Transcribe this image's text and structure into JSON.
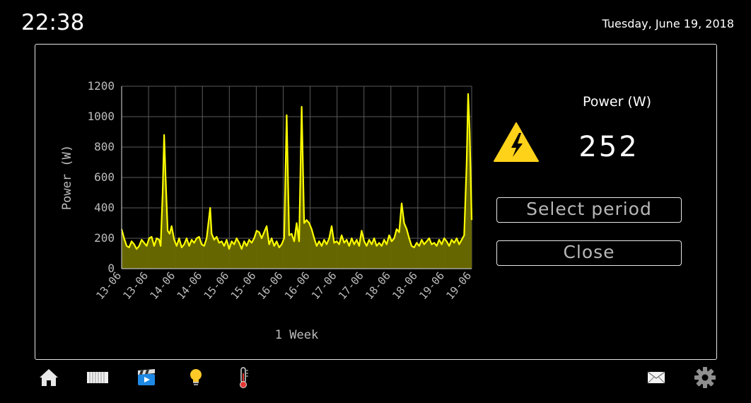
{
  "header": {
    "time": "22:38",
    "date": "Tuesday, June 19, 2018"
  },
  "power_panel": {
    "title": "Power (W)",
    "value": "252",
    "select_period_label": "Select period",
    "close_label": "Close",
    "icon": "high-voltage-warning-icon"
  },
  "nav": {
    "left": [
      "home-icon",
      "radiator-icon",
      "media-clapperboard-icon",
      "light-bulb-icon",
      "thermometer-icon"
    ],
    "right": [
      "mail-icon",
      "settings-gear-icon"
    ]
  },
  "colors": {
    "line": "#ffff00",
    "fill": "#6b6b00",
    "grid": "#5a5a5a",
    "axis_text": "#bdbdbd"
  },
  "chart_data": {
    "type": "area",
    "title": "",
    "xlabel": "1 Week",
    "ylabel": "Power (W)",
    "ylim": [
      0,
      1200
    ],
    "yticks": [
      0,
      200,
      400,
      600,
      800,
      1000,
      1200
    ],
    "xlim": [
      0,
      7
    ],
    "xtick_labels": [
      "13-06",
      "13-06",
      "14-06",
      "14-06",
      "15-06",
      "15-06",
      "16-06",
      "16-06",
      "17-06",
      "17-06",
      "18-06",
      "18-06",
      "19-06",
      "19-06"
    ],
    "grid": true,
    "series": [
      {
        "values": [
          [
            0.0,
            260
          ],
          [
            0.05,
            200
          ],
          [
            0.1,
            150
          ],
          [
            0.15,
            140
          ],
          [
            0.2,
            180
          ],
          [
            0.25,
            160
          ],
          [
            0.3,
            130
          ],
          [
            0.35,
            150
          ],
          [
            0.4,
            190
          ],
          [
            0.45,
            170
          ],
          [
            0.5,
            150
          ],
          [
            0.55,
            200
          ],
          [
            0.6,
            210
          ],
          [
            0.65,
            150
          ],
          [
            0.7,
            200
          ],
          [
            0.75,
            190
          ],
          [
            0.78,
            150
          ],
          [
            0.82,
            500
          ],
          [
            0.85,
            880
          ],
          [
            0.88,
            600
          ],
          [
            0.92,
            250
          ],
          [
            0.96,
            230
          ],
          [
            1.0,
            280
          ],
          [
            1.05,
            190
          ],
          [
            1.1,
            150
          ],
          [
            1.15,
            200
          ],
          [
            1.2,
            140
          ],
          [
            1.25,
            160
          ],
          [
            1.3,
            200
          ],
          [
            1.35,
            150
          ],
          [
            1.4,
            190
          ],
          [
            1.45,
            170
          ],
          [
            1.5,
            200
          ],
          [
            1.55,
            210
          ],
          [
            1.6,
            160
          ],
          [
            1.65,
            150
          ],
          [
            1.7,
            200
          ],
          [
            1.77,
            400
          ],
          [
            1.8,
            230
          ],
          [
            1.85,
            190
          ],
          [
            1.9,
            210
          ],
          [
            1.95,
            170
          ],
          [
            2.0,
            180
          ],
          [
            2.05,
            150
          ],
          [
            2.1,
            190
          ],
          [
            2.15,
            130
          ],
          [
            2.2,
            180
          ],
          [
            2.25,
            160
          ],
          [
            2.3,
            200
          ],
          [
            2.35,
            170
          ],
          [
            2.4,
            130
          ],
          [
            2.45,
            180
          ],
          [
            2.5,
            150
          ],
          [
            2.55,
            190
          ],
          [
            2.6,
            170
          ],
          [
            2.65,
            200
          ],
          [
            2.7,
            250
          ],
          [
            2.75,
            240
          ],
          [
            2.8,
            200
          ],
          [
            2.85,
            240
          ],
          [
            2.9,
            280
          ],
          [
            2.95,
            160
          ],
          [
            3.0,
            200
          ],
          [
            3.05,
            150
          ],
          [
            3.1,
            180
          ],
          [
            3.15,
            140
          ],
          [
            3.2,
            160
          ],
          [
            3.25,
            200
          ],
          [
            3.3,
            1010
          ],
          [
            3.35,
            220
          ],
          [
            3.4,
            230
          ],
          [
            3.45,
            180
          ],
          [
            3.5,
            300
          ],
          [
            3.55,
            180
          ],
          [
            3.6,
            1065
          ],
          [
            3.65,
            300
          ],
          [
            3.7,
            320
          ],
          [
            3.75,
            300
          ],
          [
            3.8,
            260
          ],
          [
            3.85,
            200
          ],
          [
            3.9,
            150
          ],
          [
            3.95,
            180
          ],
          [
            4.0,
            150
          ],
          [
            4.05,
            190
          ],
          [
            4.1,
            160
          ],
          [
            4.15,
            200
          ],
          [
            4.2,
            280
          ],
          [
            4.25,
            170
          ],
          [
            4.3,
            180
          ],
          [
            4.35,
            160
          ],
          [
            4.4,
            220
          ],
          [
            4.45,
            170
          ],
          [
            4.5,
            190
          ],
          [
            4.55,
            150
          ],
          [
            4.6,
            200
          ],
          [
            4.65,
            160
          ],
          [
            4.7,
            190
          ],
          [
            4.75,
            150
          ],
          [
            4.8,
            250
          ],
          [
            4.85,
            180
          ],
          [
            4.9,
            150
          ],
          [
            4.95,
            190
          ],
          [
            5.0,
            160
          ],
          [
            5.05,
            200
          ],
          [
            5.1,
            150
          ],
          [
            5.15,
            170
          ],
          [
            5.2,
            150
          ],
          [
            5.25,
            190
          ],
          [
            5.3,
            160
          ],
          [
            5.35,
            220
          ],
          [
            5.4,
            180
          ],
          [
            5.45,
            200
          ],
          [
            5.5,
            260
          ],
          [
            5.55,
            240
          ],
          [
            5.6,
            430
          ],
          [
            5.65,
            300
          ],
          [
            5.7,
            260
          ],
          [
            5.75,
            200
          ],
          [
            5.8,
            150
          ],
          [
            5.85,
            140
          ],
          [
            5.9,
            170
          ],
          [
            5.95,
            150
          ],
          [
            6.0,
            190
          ],
          [
            6.05,
            160
          ],
          [
            6.1,
            180
          ],
          [
            6.15,
            200
          ],
          [
            6.2,
            160
          ],
          [
            6.25,
            170
          ],
          [
            6.3,
            150
          ],
          [
            6.35,
            190
          ],
          [
            6.4,
            160
          ],
          [
            6.45,
            200
          ],
          [
            6.5,
            180
          ],
          [
            6.55,
            150
          ],
          [
            6.6,
            190
          ],
          [
            6.65,
            170
          ],
          [
            6.7,
            200
          ],
          [
            6.75,
            160
          ],
          [
            6.8,
            190
          ],
          [
            6.85,
            220
          ],
          [
            6.9,
            700
          ],
          [
            6.93,
            1150
          ],
          [
            6.96,
            900
          ],
          [
            7.0,
            320
          ]
        ]
      }
    ]
  }
}
